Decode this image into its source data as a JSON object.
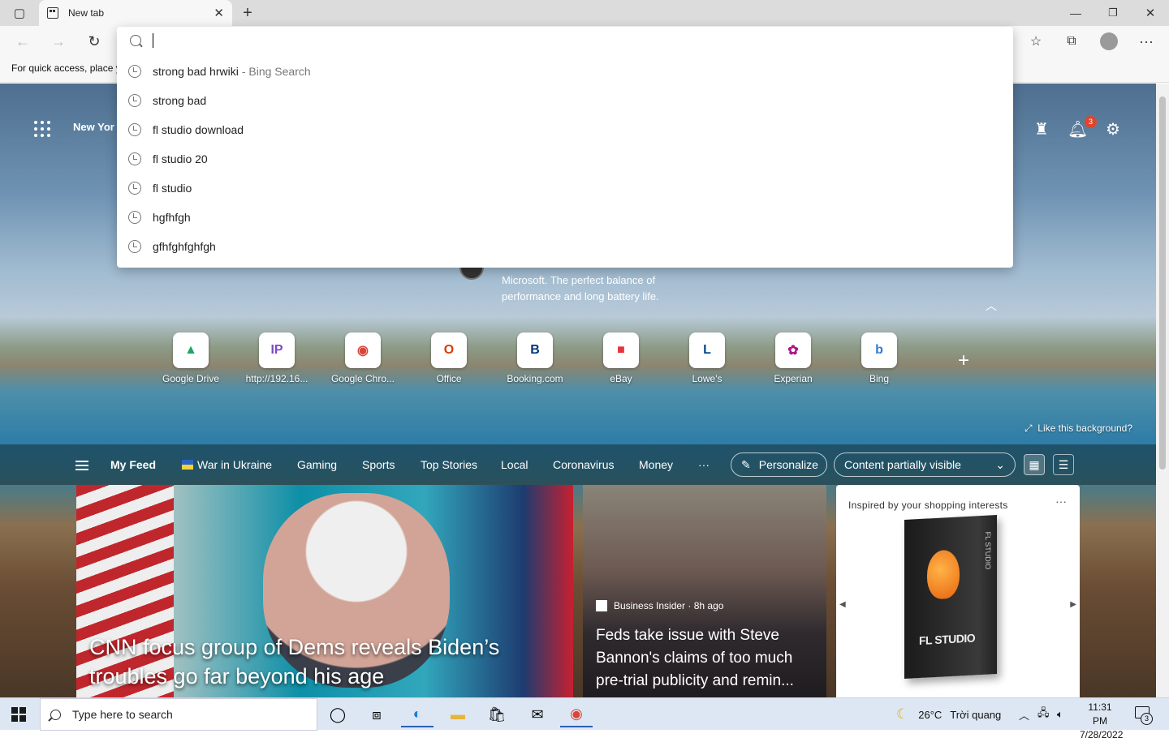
{
  "browser": {
    "tab_title": "New tab",
    "favorites_hint": "For quick access, place y"
  },
  "omnibox": {
    "value": "",
    "suggestions": [
      {
        "text": "strong bad hrwiki",
        "sub": "- Bing Search"
      },
      {
        "text": "strong bad",
        "sub": ""
      },
      {
        "text": "fl studio download",
        "sub": ""
      },
      {
        "text": "fl studio 20",
        "sub": ""
      },
      {
        "text": "fl studio",
        "sub": ""
      },
      {
        "text": "hgfhfgh",
        "sub": ""
      },
      {
        "text": "gfhfghfghfgh",
        "sub": ""
      }
    ]
  },
  "ntp": {
    "location": "New Yor",
    "notification_count": "3",
    "promo_line1": "Microsoft. The perfect balance of",
    "promo_line2": "performance and long battery life.",
    "like_background": "Like this background?",
    "tiles": [
      {
        "label": "Google Drive",
        "glyph": "▲",
        "color": "#1fa463"
      },
      {
        "label": "http://192.16...",
        "glyph": "IP",
        "color": "#7b4bc4"
      },
      {
        "label": "Google Chro...",
        "glyph": "◉",
        "color": "#db4437"
      },
      {
        "label": "Office",
        "glyph": "O",
        "color": "#d83b01"
      },
      {
        "label": "Booking.com",
        "glyph": "B",
        "color": "#003580"
      },
      {
        "label": "eBay",
        "glyph": "■",
        "color": "#e53238"
      },
      {
        "label": "Lowe's",
        "glyph": "L",
        "color": "#004990"
      },
      {
        "label": "Experian",
        "glyph": "✿",
        "color": "#af1685"
      },
      {
        "label": "Bing",
        "glyph": "b",
        "color": "#2f7bd6"
      }
    ],
    "feed": {
      "my_feed": "My Feed",
      "tabs": [
        "War in Ukraine",
        "Gaming",
        "Sports",
        "Top Stories",
        "Local",
        "Coronavirus",
        "Money"
      ],
      "more": "···",
      "personalize": "Personalize",
      "content_visibility": "Content partially visible"
    },
    "cards": {
      "main_title_line1": "CNN focus group of Dems reveals Biden’s",
      "main_title_line2": "troubles go far beyond his age",
      "second_source": "Business Insider · 8h ago",
      "second_title_line1": "Feds take issue with Steve",
      "second_title_line2": "Bannon's claims of too much",
      "second_title_line3": "pre-trial publicity and remin...",
      "shopping_header": "Inspired by your shopping interests",
      "product_brand": "FL STUDIO"
    }
  },
  "taskbar": {
    "search_placeholder": "Type here to search",
    "weather_temp": "26°C",
    "weather_desc": "Trời quang",
    "time": "11:31 PM",
    "date": "7/28/2022",
    "notif_count": "3"
  }
}
